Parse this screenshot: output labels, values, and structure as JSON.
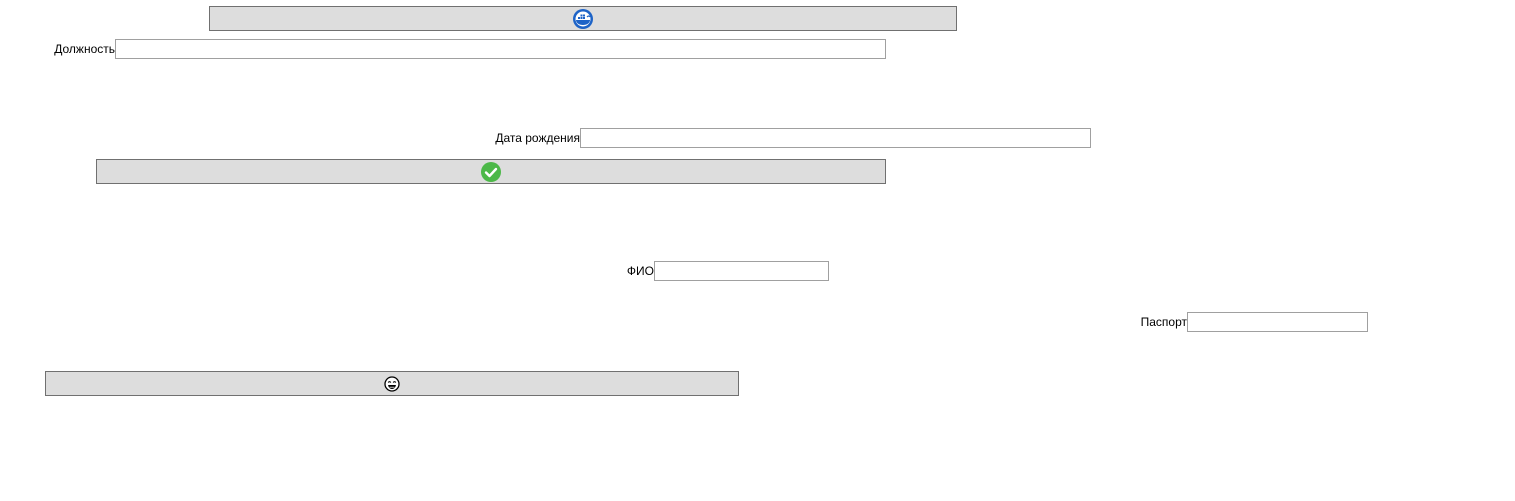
{
  "buttons": {
    "top": {
      "label": "",
      "icon": "docker-whale-icon"
    },
    "confirm": {
      "label": "",
      "icon": "checkmark-circle-icon"
    },
    "bottom": {
      "label": "",
      "icon": "emoji-face-icon"
    }
  },
  "fields": {
    "position": {
      "label": "Должность",
      "value": ""
    },
    "birth_date": {
      "label": "Дата рождения",
      "value": ""
    },
    "full_name": {
      "label": "ФИО",
      "value": ""
    },
    "passport": {
      "label": "Паспорт",
      "value": ""
    }
  },
  "colors": {
    "button_bg": "#dddddd",
    "button_border": "#707070",
    "field_border": "#a0a0a0",
    "docker_blue": "#1d63c7",
    "check_green": "#4cb848"
  }
}
